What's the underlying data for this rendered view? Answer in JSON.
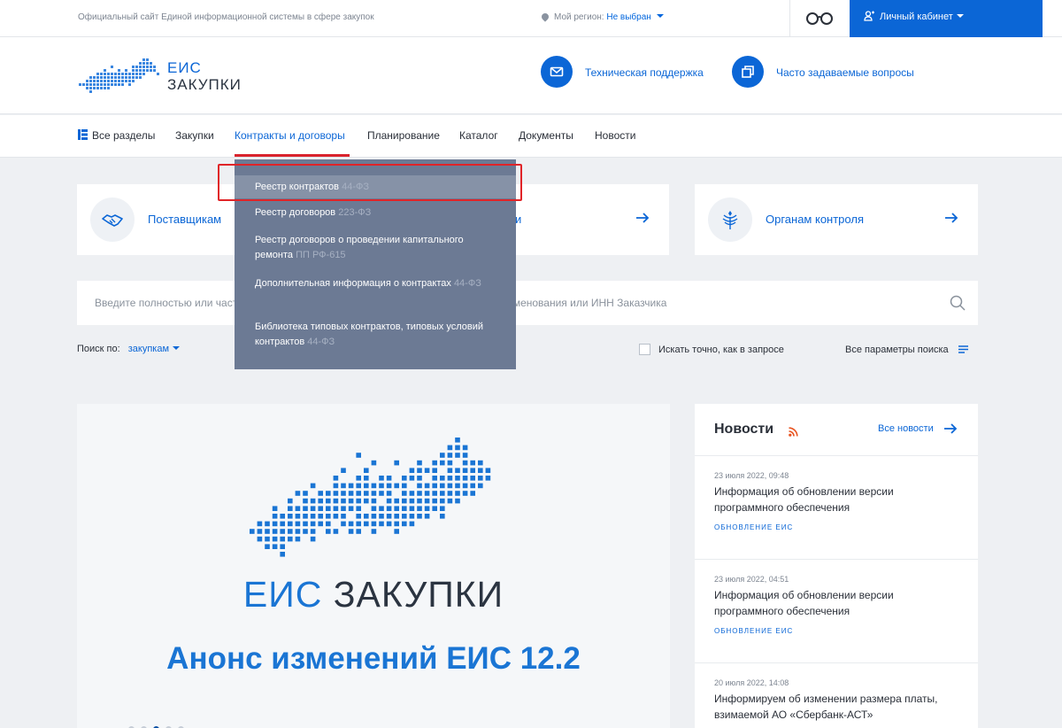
{
  "topbar": {
    "site_description": "Официальный сайт Единой информационной системы в сфере закупок",
    "region_label": "Мой регион:",
    "region_value": "Не выбран",
    "cabinet_label": "Личный кабинет"
  },
  "header": {
    "logo_line1": "ЕИС",
    "logo_line2": "ЗАКУПКИ",
    "support_label": "Техническая поддержка",
    "faq_label": "Часто задаваемые вопросы"
  },
  "nav": {
    "items": [
      "Все разделы",
      "Закупки",
      "Контракты и договоры",
      "Планирование",
      "Каталог",
      "Документы",
      "Новости"
    ],
    "active_index": 2
  },
  "dropdown": {
    "items": [
      {
        "text": "Реестр контрактов",
        "law": "44-ФЗ"
      },
      {
        "text": "Реестр договоров",
        "law": "223-ФЗ"
      },
      {
        "text": "Реестр договоров о проведении капитального ремонта",
        "law": "ПП РФ-615"
      },
      {
        "text": "Дополнительная информация о контрактах",
        "law": "44-ФЗ"
      },
      {
        "text": "Библиотека типовых контрактов, типовых условий контрактов",
        "law": "44-ФЗ"
      }
    ]
  },
  "cards": {
    "suppliers": "Поставщикам",
    "hidden_partial": "и",
    "control": "Органам контроля"
  },
  "search": {
    "placeholder": "Введите полностью или часть номера, идентификационного кода закупки (ИКЗ), наименования или ИНН Заказчика"
  },
  "search_options": {
    "search_by_label": "Поиск по:",
    "search_by_value": "закупкам",
    "exact_label": "Искать точно, как в запросе",
    "all_params_label": "Все параметры поиска"
  },
  "banner": {
    "brand1": "ЕИС",
    "brand2": "ЗАКУПКИ",
    "headline": "Анонс изменений ЕИС 12.2",
    "slide_count": 5,
    "active_slide": 3
  },
  "news": {
    "title": "Новости",
    "all_label": "Все новости",
    "items": [
      {
        "date": "23 июля 2022, 09:48",
        "text": "Информация об обновлении версии программного обеспечения",
        "tag": "ОБНОВЛЕНИЕ ЕИС"
      },
      {
        "date": "23 июля 2022, 04:51",
        "text": "Информация об обновлении версии программного обеспечения",
        "tag": "ОБНОВЛЕНИЕ ЕИС"
      },
      {
        "date": "20 июля 2022, 14:08",
        "text": "Информируем об изменении размера платы, взимаемой АО «Сбербанк-АСТ»",
        "tag": ""
      }
    ]
  },
  "colors": {
    "brand_blue": "#0b66d6",
    "dropdown_bg": "#6c7a94",
    "highlight_red": "#e02428"
  }
}
